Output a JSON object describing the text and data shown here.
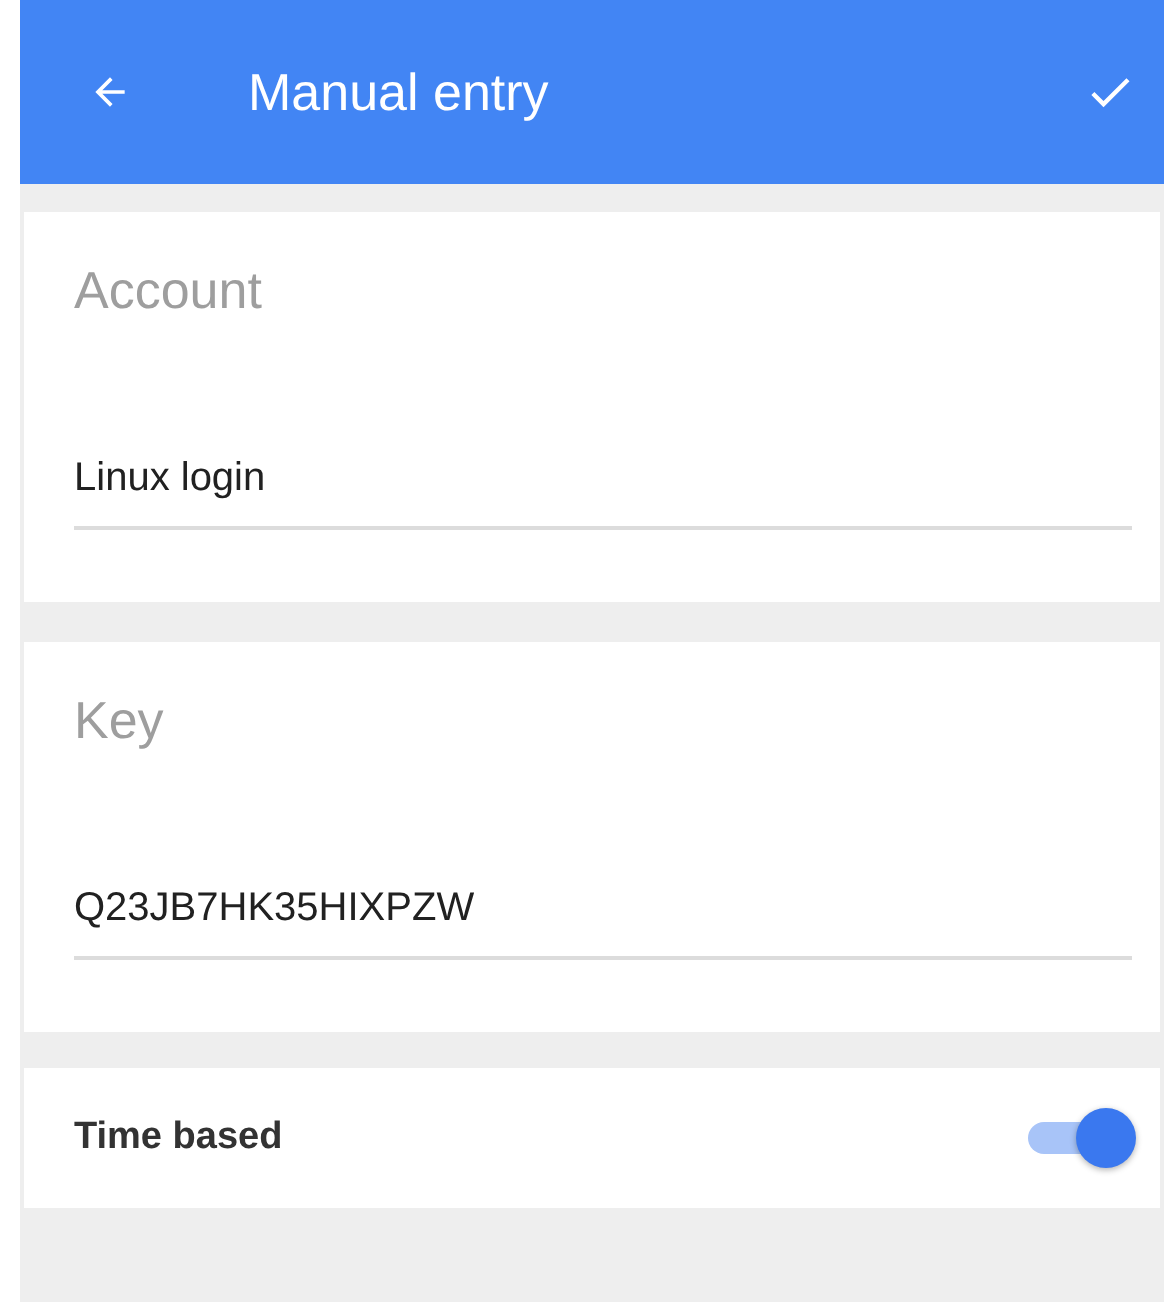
{
  "app_bar": {
    "title": "Manual entry"
  },
  "fields": [
    {
      "label": "Account",
      "value": "Linux login"
    },
    {
      "label": "Key",
      "value": "Q23JB7HK35HIXPZW"
    }
  ],
  "toggle": {
    "label": "Time based",
    "on": true
  }
}
